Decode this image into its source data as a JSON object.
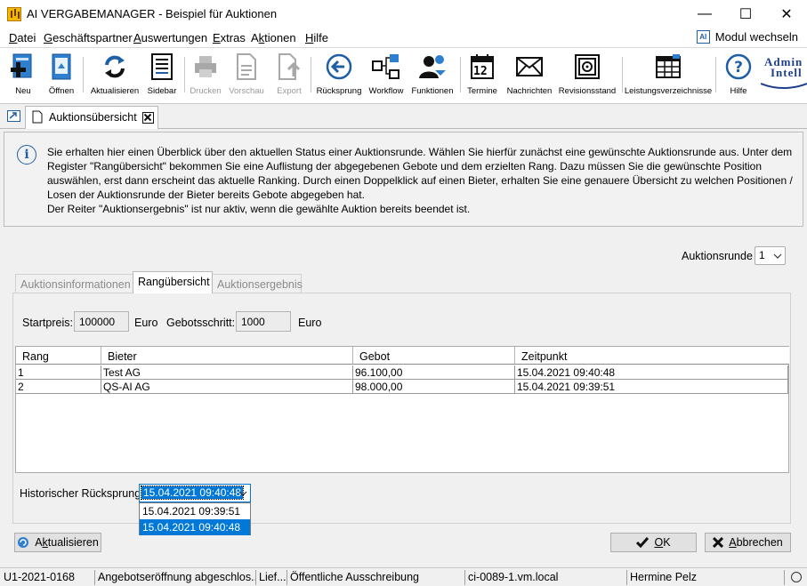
{
  "window": {
    "title": "AI VERGABEMANAGER - Beispiel für Auktionen",
    "minimize": "—",
    "maximize": "☐",
    "close": "✕"
  },
  "menu": [
    {
      "pre": "",
      "u": "D",
      "post": "atei"
    },
    {
      "pre": "",
      "u": "G",
      "post": "eschäftspartner"
    },
    {
      "pre": "",
      "u": "A",
      "post": "uswertungen"
    },
    {
      "pre": "",
      "u": "E",
      "post": "xtras"
    },
    {
      "pre": "A",
      "u": "k",
      "post": "tionen"
    },
    {
      "pre": "",
      "u": "H",
      "post": "ilfe"
    }
  ],
  "modul": {
    "label": "Modul wechseln",
    "icon_text": "AI"
  },
  "toolbar": {
    "neu": "Neu",
    "oeffnen": "Öffnen",
    "aktualisieren": "Aktualisieren",
    "sidebar": "Sidebar",
    "drucken": "Drucken",
    "vorschau": "Vorschau",
    "export": "Export",
    "ruecksprung": "Rücksprung",
    "workflow": "Workflow",
    "funktionen": "Funktionen",
    "termine": "Termine",
    "termine_day": "12",
    "nachrichten": "Nachrichten",
    "revisionsstand": "Revisionsstand",
    "leistungsverzeichnisse": "Leistungsverzeichnisse",
    "hilfe": "Hilfe",
    "logo_line1": "Admin",
    "logo_line2": "Intell"
  },
  "doc_tab": {
    "label": "Auktionsübersicht"
  },
  "info": {
    "lines": [
      "Sie erhalten hier einen Überblick über den aktuellen Status einer Auktionsrunde. Wählen Sie hierfür zunächst eine gewünschte Auktionsrunde aus. Unter dem",
      "Register \"Rangübersicht\" bekommen Sie eine Auflistung der abgegebenen Gebote und dem erzielten Rang. Dazu müssen Sie die gewünschte Position",
      "auswählen, erst dann erscheint das aktuelle Ranking. Durch einen Doppelklick auf einen Bieter, erhalten Sie eine genauere Übersicht zu welchen Positionen /",
      "Losen der Auktionsrunde der Bieter bereits Gebote abgegeben hat.",
      "Der Reiter \"Auktionsergebnis\" ist nur aktiv, wenn die gewählte Auktion bereits beendet ist."
    ]
  },
  "auktionsrunde": {
    "label": "Auktionsrunde",
    "value": "1"
  },
  "tabs": {
    "info": "Auktionsinformationen",
    "rang": "Rangübersicht",
    "ergebnis": "Auktionsergebnis"
  },
  "fields": {
    "startpreis_label": "Startpreis:",
    "startpreis_value": "100000",
    "euro1": "Euro",
    "gebotsschritt_label": "Gebotsschritt:",
    "gebotsschritt_value": "1000",
    "euro2": "Euro"
  },
  "table": {
    "columns": [
      "Rang",
      "Bieter",
      "Gebot",
      "Zeitpunkt"
    ],
    "rows": [
      [
        "1",
        "Test AG",
        "96.100,00",
        "15.04.2021 09:40:48"
      ],
      [
        "2",
        "QS-AI AG",
        "98.000,00",
        "15.04.2021 09:39:51"
      ]
    ]
  },
  "historisch": {
    "label": "Historischer Rücksprung",
    "value": "15.04.2021 09:40:48",
    "options": [
      "15.04.2021 09:39:51",
      "15.04.2021 09:40:48"
    ]
  },
  "buttons": {
    "aktualisieren_pre": "A",
    "aktualisieren_u": "k",
    "aktualisieren_post": "tualisieren",
    "ok_u": "O",
    "ok_post": "K",
    "abbrechen_u": "A",
    "abbrechen_post": "bbrechen"
  },
  "status": {
    "id": "U1-2021-0168",
    "state": "Angebotseröffnung abgeschlos...",
    "lief": "Lief...",
    "art": "Öffentliche Ausschreibung",
    "host": "ci-0089-1.vm.local",
    "user": "Hermine Pelz"
  }
}
